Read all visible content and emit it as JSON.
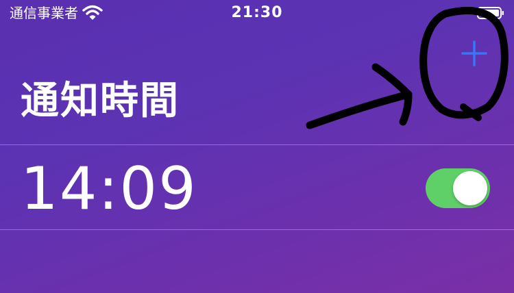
{
  "status_bar": {
    "carrier": "通信事業者",
    "time": "21:30",
    "wifi_icon": "wifi-icon",
    "battery_icon": "battery-icon"
  },
  "header": {
    "add_icon": "plus-icon",
    "title": "通知時間"
  },
  "alarms": [
    {
      "time": "14:09",
      "enabled": true
    }
  ],
  "colors": {
    "accent": "#3478f6",
    "toggle_on": "#5fd068",
    "background_top": "#5a2fb0",
    "background_bottom": "#7a2fa6",
    "annotation_ink": "#000000"
  }
}
